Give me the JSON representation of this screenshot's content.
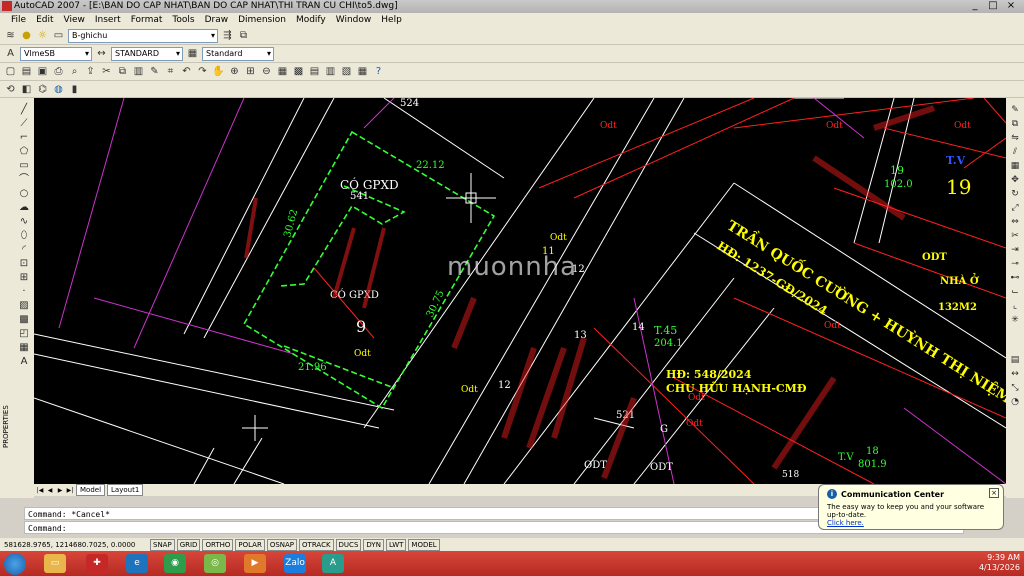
{
  "window": {
    "title": "AutoCAD 2007 - [E:\\BAN DO CAP NHAT\\BAN DO CAP NHAT\\THI TRAN CU CHI\\to5.dwg]",
    "controls": [
      "_",
      "□",
      "×"
    ]
  },
  "menu": [
    "File",
    "Edit",
    "View",
    "Insert",
    "Format",
    "Tools",
    "Draw",
    "Dimension",
    "Modify",
    "Window",
    "Help"
  ],
  "layer_toolbar": {
    "layer": "B-ghichu"
  },
  "style_toolbar": {
    "text_style": "VlmeSB",
    "dim_style": "STANDARD",
    "table_style": "Standard"
  },
  "drawing": {
    "labels": [
      {
        "text": "524",
        "color": "#ffffff"
      },
      {
        "text": "CÓ GPXD",
        "color": "#ffffff"
      },
      {
        "text": "541",
        "color": "#ffffff"
      },
      {
        "text": "22.12",
        "color": "#00ff00"
      },
      {
        "text": "30.62",
        "color": "#00ff00"
      },
      {
        "text": "30.75",
        "color": "#00ff00"
      },
      {
        "text": "21.96",
        "color": "#00ff00"
      },
      {
        "text": "CÓ GPXD",
        "color": "#ffffff"
      },
      {
        "text": "9",
        "color": "#ffffff"
      },
      {
        "text": "Odt",
        "color": "#ffff00"
      },
      {
        "text": "Odt",
        "color": "#ffff00"
      },
      {
        "text": "11",
        "color": "#ffff00"
      },
      {
        "text": "12",
        "color": "#ffffff"
      },
      {
        "text": "13",
        "color": "#ffffff"
      },
      {
        "text": "14",
        "color": "#ffffff"
      },
      {
        "text": "12",
        "color": "#ffffff"
      },
      {
        "text": "Odt",
        "color": "#ffff00"
      },
      {
        "text": "T.45",
        "color": "#00ff00"
      },
      {
        "text": "204.1",
        "color": "#00ff00"
      },
      {
        "text": "HĐ: 548/2024",
        "color": "#ffff00"
      },
      {
        "text": "CHU HỮU HẠNH-CMĐ",
        "color": "#ffff00"
      },
      {
        "text": "Odt",
        "color": "#ff2222"
      },
      {
        "text": "521",
        "color": "#ffffff"
      },
      {
        "text": "G",
        "color": "#ffffff"
      },
      {
        "text": "ODT",
        "color": "#ffffff"
      },
      {
        "text": "ODT",
        "color": "#ffffff"
      },
      {
        "text": "T.V",
        "color": "#00ff00"
      },
      {
        "text": "18",
        "color": "#00ff00"
      },
      {
        "text": "801.9",
        "color": "#00ff00"
      },
      {
        "text": "518",
        "color": "#ffffff"
      },
      {
        "text": "19",
        "color": "#00ff00"
      },
      {
        "text": "102.0",
        "color": "#00ff00"
      },
      {
        "text": "T.V",
        "color": "#3355ff"
      },
      {
        "text": "19",
        "color": "#ffff00"
      },
      {
        "text": "Odt",
        "color": "#ff2222"
      },
      {
        "text": "ODT",
        "color": "#ffff00"
      },
      {
        "text": "NHÀ Ở",
        "color": "#ffff00"
      },
      {
        "text": "132M2",
        "color": "#ffff00"
      },
      {
        "text": "Odt",
        "color": "#ff2222"
      },
      {
        "text": "TRẦN QUỐC CƯỜNG + HUỲNH THỊ NIỆM-CMĐ",
        "color": "#ffff00"
      },
      {
        "text": "HĐ: 1237-GĐ/2024",
        "color": "#ffff00"
      },
      {
        "text": "Odt",
        "color": "#ff2222"
      },
      {
        "text": "Odt",
        "color": "#ff2222"
      },
      {
        "text": "Odt",
        "color": "#ff2222"
      }
    ],
    "watermark": "muonnha"
  },
  "tabs": [
    "Model",
    "Layout1"
  ],
  "command": {
    "line1": "Command: *Cancel*",
    "line2": "Command:"
  },
  "status": {
    "coords": "581628.9765, 1214680.7025, 0.0000",
    "buttons": [
      "SNAP",
      "GRID",
      "ORTHO",
      "POLAR",
      "OSNAP",
      "OTRACK",
      "DUCS",
      "DYN",
      "LWT",
      "MODEL"
    ]
  },
  "popup": {
    "title": "Communication Center",
    "body": "The easy way to keep you and your software up-to-date.",
    "link": "Click here."
  },
  "taskbar": {
    "time": "9:39 AM",
    "date": "4/13/2026",
    "zalo": "Zalo"
  }
}
